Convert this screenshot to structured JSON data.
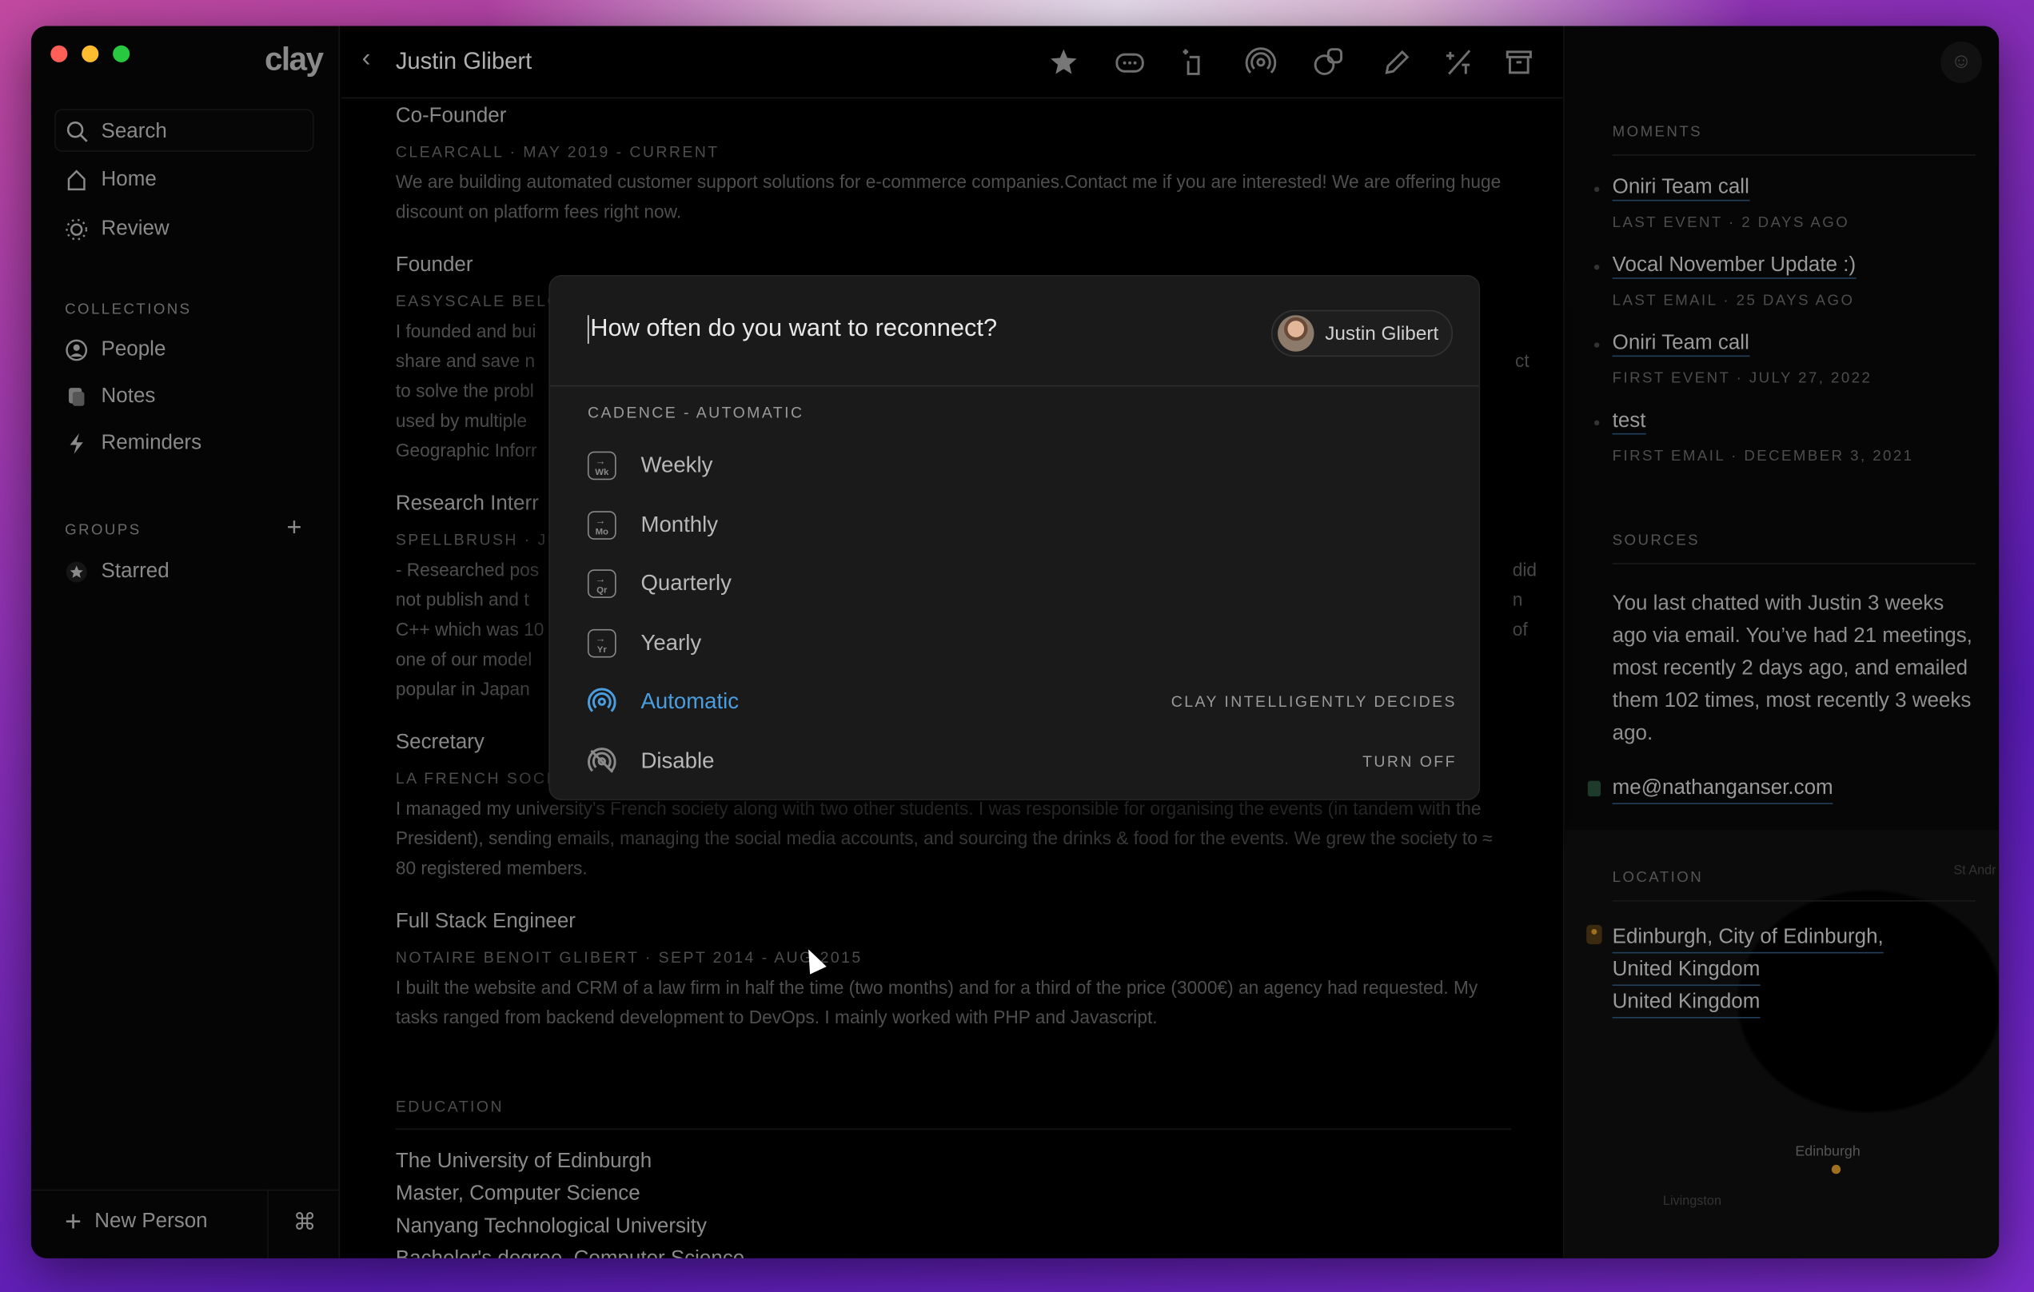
{
  "app": {
    "logo": "clay",
    "title": "Justin Glibert"
  },
  "window_controls": {
    "close": "#ff5f57",
    "minimize": "#febc2e",
    "maximize": "#28c840"
  },
  "sidebar": {
    "search_placeholder": "Search",
    "nav": [
      {
        "label": "Home",
        "icon": "home-icon"
      },
      {
        "label": "Review",
        "icon": "sun-icon"
      }
    ],
    "collections_header": "COLLECTIONS",
    "collections": [
      {
        "label": "People",
        "icon": "person-circle-icon"
      },
      {
        "label": "Notes",
        "icon": "notes-icon"
      },
      {
        "label": "Reminders",
        "icon": "bolt-icon"
      }
    ],
    "groups_header": "GROUPS",
    "groups": [
      {
        "label": "Starred",
        "icon": "star-icon"
      }
    ],
    "new_person": "New Person",
    "shortcut": "⌘"
  },
  "toolbar": [
    "star-icon",
    "message-icon",
    "crop-icon",
    "signal-icon",
    "faces-icon",
    "pencil-icon",
    "split-icon",
    "archive-icon"
  ],
  "main": {
    "jobs": [
      {
        "title": "Co-Founder",
        "meta": "CLEARCALL · MAY 2019 - CURRENT",
        "desc": "We are building automated customer support solutions for e-commerce companies.Contact me if you are interested! We are offering huge discount on platform fees right now."
      },
      {
        "title": "Founder",
        "meta": "EASYSCALE BELG",
        "desc_lines": [
          "I founded and bui",
          "share and save n",
          "to solve the probl",
          "used by multiple",
          "Geographic Inforr"
        ],
        "right_frags": [
          "ct"
        ]
      },
      {
        "title": "Research Interr",
        "meta": "SPELLBRUSH · JU",
        "desc_lines": [
          "- Researched pos",
          "not publish and t",
          "C++ which was 10",
          "one of our model",
          "popular in Japan"
        ],
        "right_frags": [
          "did",
          "n",
          "of"
        ]
      },
      {
        "title": "Secretary",
        "meta": "LA FRENCH SOCI",
        "desc": "I managed my university's French society along with two other students. I was responsible for organising the events (in tandem with the President), sending emails, managing the social media accounts, and sourcing the drinks & food for the events. We grew the society to ≈ 80 registered members."
      },
      {
        "title": "Full Stack Engineer",
        "meta": "NOTAIRE BENOIT GLIBERT · SEPT 2014 - AUG 2015",
        "desc": "I built the website and CRM of a law firm in half the time (two months) and for a third of the price (3000€) an agency had requested. My tasks ranged from backend development to DevOps. I mainly worked with PHP and Javascript."
      }
    ],
    "education_header": "EDUCATION",
    "education": [
      "The University of Edinburgh",
      "Master, Computer Science",
      "Nanyang Technological University",
      "Bachelor's degree, Computer Science"
    ]
  },
  "right": {
    "moments_header": "MOMENTS",
    "moments": [
      {
        "title": "Oniri Team call",
        "meta": "LAST EVENT · 2 DAYS AGO"
      },
      {
        "title": "Vocal November Update :)",
        "meta": "LAST EMAIL · 25 DAYS AGO"
      },
      {
        "title": "Oniri Team call",
        "meta": "FIRST EVENT · JULY 27, 2022"
      },
      {
        "title": "test",
        "meta": "FIRST EMAIL · DECEMBER 3, 2021"
      }
    ],
    "sources_header": "SOURCES",
    "sources_text": "You last chatted with Justin 3 weeks ago via email. You’ve had 21 meetings, most recently 2 days ago, and emailed them 102 times, most recently 3 weeks ago.",
    "email": "me@nathanganser.com",
    "location_header": "LOCATION",
    "location": [
      "Edinburgh, City of Edinburgh,",
      "United Kingdom",
      "United Kingdom"
    ],
    "map_labels": [
      "Edinburgh",
      "Livingston",
      "St Andr"
    ]
  },
  "modal": {
    "question": "How often do you want to reconnect?",
    "contact": "Justin Glibert",
    "cadence_header": "CADENCE - AUTOMATIC",
    "accent": "#4a9ee0",
    "options": [
      {
        "label": "Weekly",
        "badge": "Wk"
      },
      {
        "label": "Monthly",
        "badge": "Mo"
      },
      {
        "label": "Quarterly",
        "badge": "Qr"
      },
      {
        "label": "Yearly",
        "badge": "Yr"
      },
      {
        "label": "Automatic",
        "hint": "CLAY INTELLIGENTLY DECIDES",
        "selected": true
      },
      {
        "label": "Disable",
        "hint": "TURN OFF"
      }
    ]
  }
}
